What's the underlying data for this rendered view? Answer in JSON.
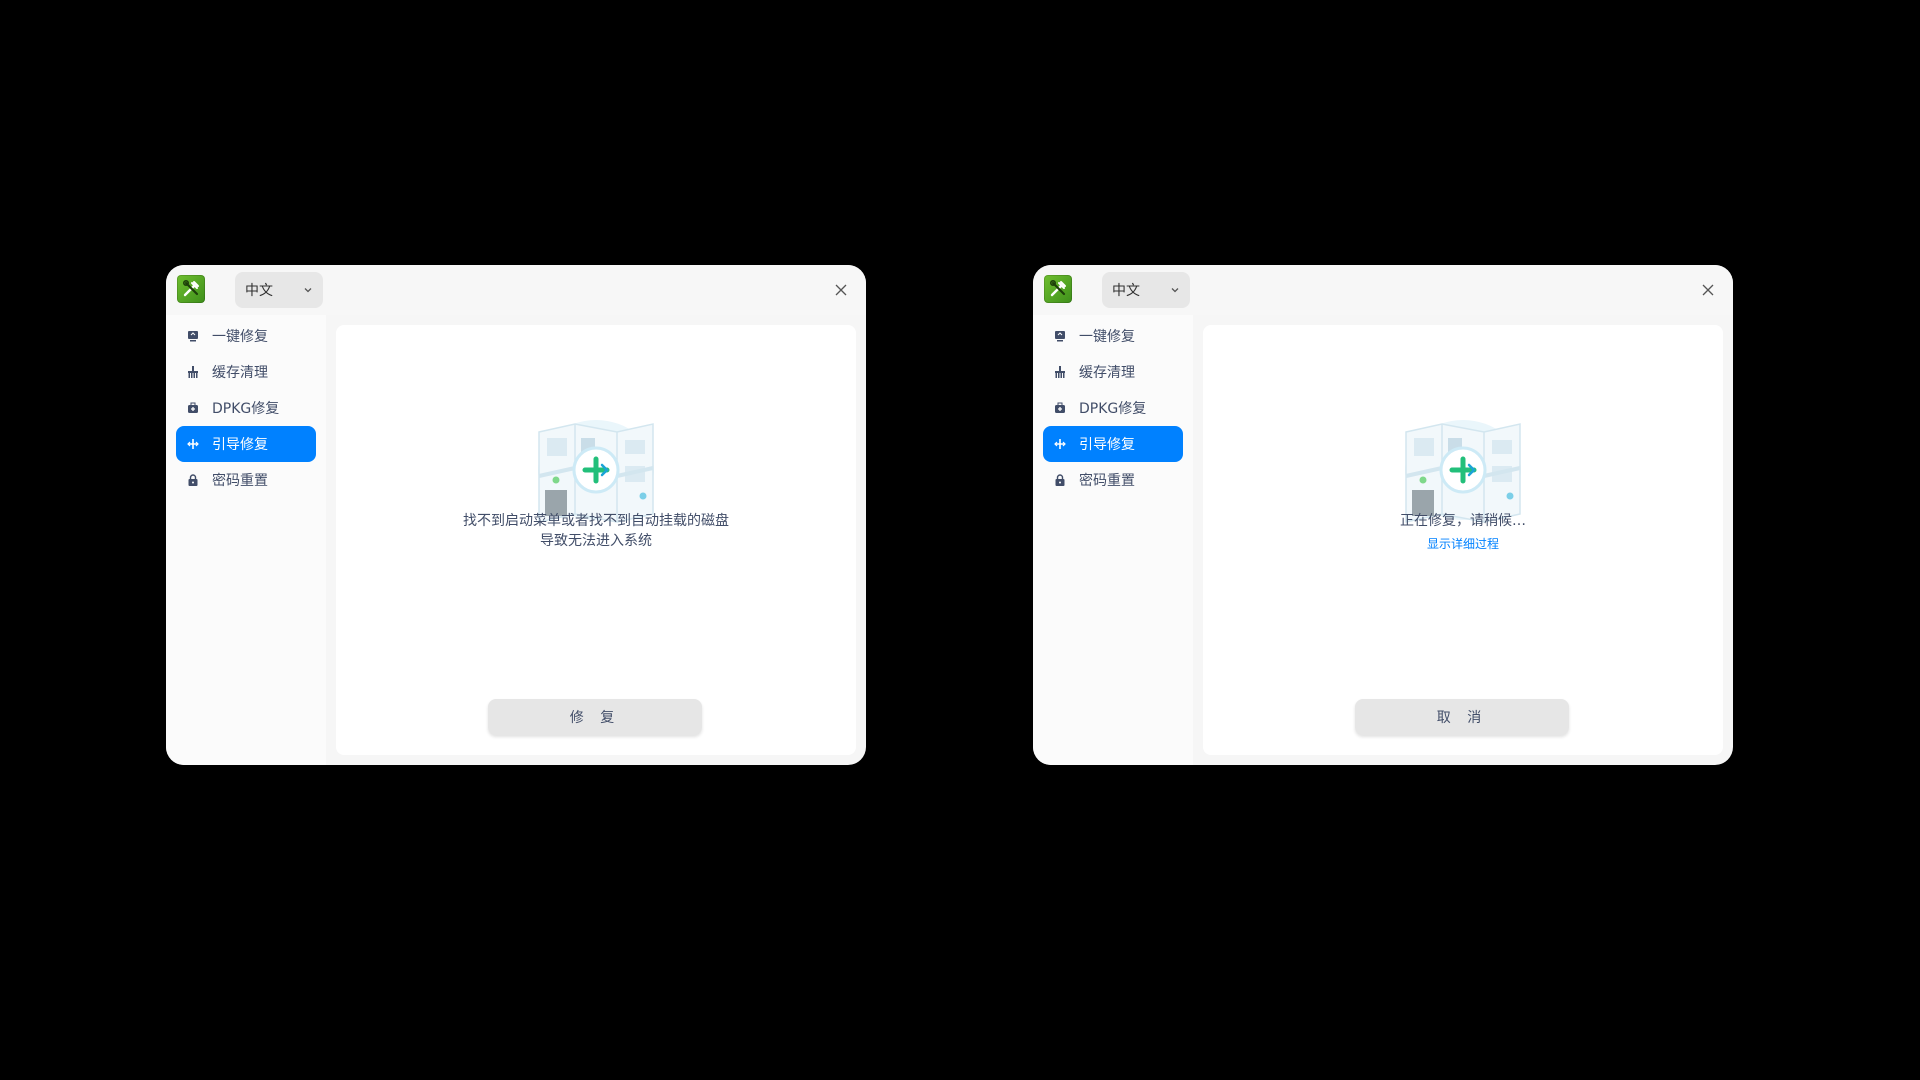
{
  "windows": [
    {
      "lang_select": "中文",
      "nav": [
        {
          "label": "一键修复",
          "icon": "one-click-repair-icon"
        },
        {
          "label": "缓存清理",
          "icon": "cache-clean-icon"
        },
        {
          "label": "DPKG修复",
          "icon": "dpkg-repair-icon"
        },
        {
          "label": "引导修复",
          "icon": "boot-repair-icon",
          "active": true
        },
        {
          "label": "密码重置",
          "icon": "password-reset-icon"
        }
      ],
      "message_line1": "找不到启动菜单或者找不到自动挂载的磁盘",
      "message_line2": "导致无法进入系统",
      "button_label": "修 复"
    },
    {
      "lang_select": "中文",
      "nav": [
        {
          "label": "一键修复",
          "icon": "one-click-repair-icon"
        },
        {
          "label": "缓存清理",
          "icon": "cache-clean-icon"
        },
        {
          "label": "DPKG修复",
          "icon": "dpkg-repair-icon"
        },
        {
          "label": "引导修复",
          "icon": "boot-repair-icon",
          "active": true
        },
        {
          "label": "密码重置",
          "icon": "password-reset-icon"
        }
      ],
      "status_text": "正在修复，请稍候…",
      "details_link": "显示详细过程",
      "button_label": "取 消"
    }
  ],
  "colors": {
    "accent": "#0081ff",
    "text": "#414d68",
    "app_icon": "#4fa224"
  }
}
